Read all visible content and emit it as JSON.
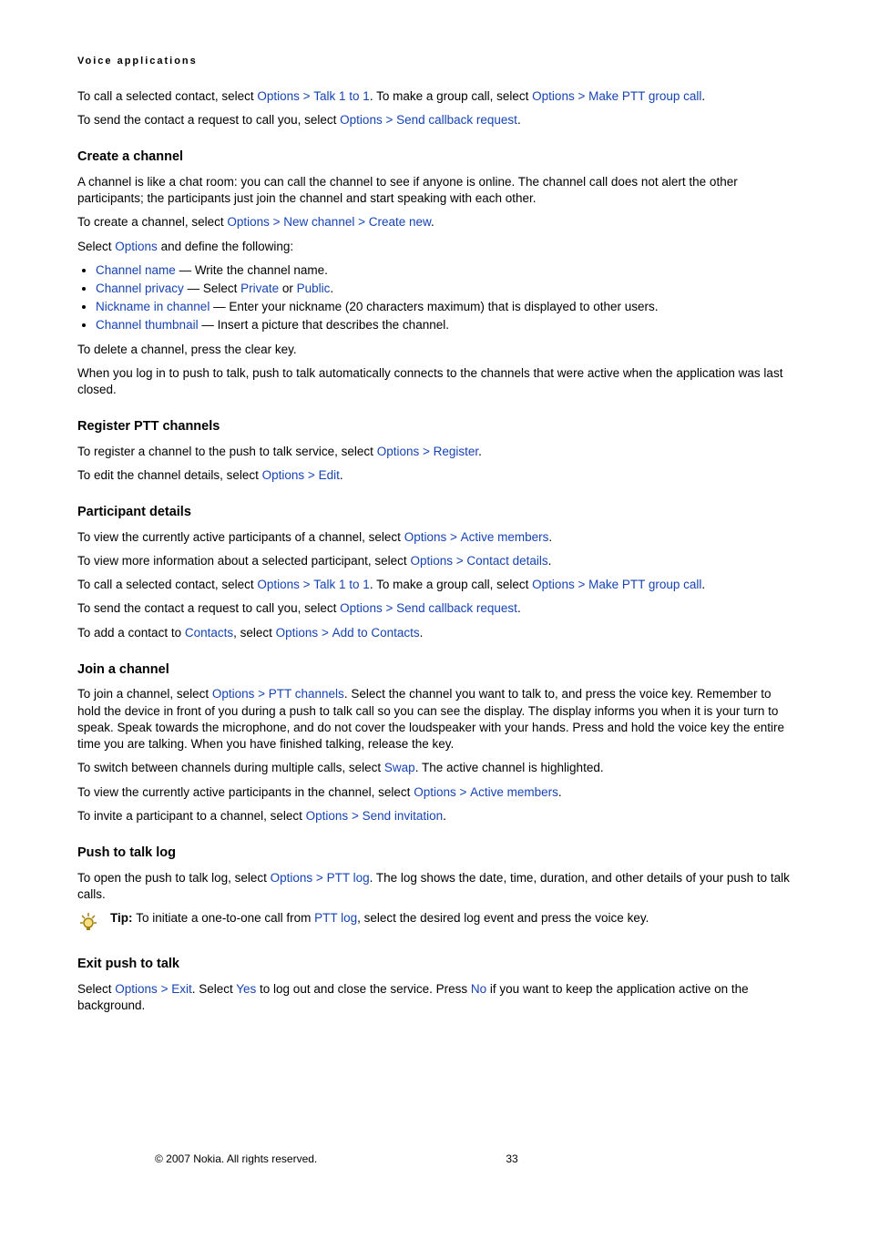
{
  "header": "Voice applications",
  "intro": [
    {
      "pre": "To call a selected contact, select ",
      "cmds": [
        [
          "Options",
          "Talk 1 to 1"
        ]
      ],
      "mid": ". To make a group call, select ",
      "cmds2": [
        [
          "Options",
          "Make PTT group call"
        ]
      ],
      "post": "."
    },
    {
      "pre": "To send the contact a request to call you, select ",
      "cmds": [
        [
          "Options",
          "Send callback request"
        ]
      ],
      "post": "."
    }
  ],
  "s1": {
    "title": "Create a channel",
    "p1": "A channel is like a chat room: you can call the channel to see if anyone is online. The channel call does not alert the other participants; the participants just join the channel and start speaking with each other.",
    "p2": {
      "pre": "To create a channel, select ",
      "cmds": [
        [
          "Options",
          "New channel",
          "Create new"
        ]
      ],
      "post": "."
    },
    "p3": {
      "pre": "Select ",
      "cmd": "Options",
      "post": " and define the following:"
    },
    "items": [
      {
        "name": "Channel name",
        "desc": " — Write the channel name."
      },
      {
        "name": "Channel privacy",
        "desc": " — Select ",
        "cmd1": "Private",
        "mid": " or ",
        "cmd2": "Public",
        "post": "."
      },
      {
        "name": "Nickname in channel",
        "desc": " — Enter your nickname (20 characters maximum) that is displayed to other users."
      },
      {
        "name": "Channel thumbnail",
        "desc": " — Insert a picture that describes the channel."
      }
    ],
    "p4": "To delete a channel, press the clear key.",
    "p5": "When you log in to push to talk, push to talk automatically connects to the channels that were active when the application was last closed."
  },
  "s2": {
    "title": "Register PTT channels",
    "p1": {
      "pre": "To register a channel to the push to talk service, select ",
      "cmds": [
        [
          "Options",
          "Register"
        ]
      ],
      "post": "."
    },
    "p2": {
      "pre": "To edit the channel details, select ",
      "cmds": [
        [
          "Options",
          "Edit"
        ]
      ],
      "post": "."
    }
  },
  "s3": {
    "title": "Participant details",
    "p1": {
      "pre": "To view the currently active participants of a channel, select ",
      "cmds": [
        [
          "Options",
          "Active members"
        ]
      ],
      "post": "."
    },
    "p2": {
      "pre": "To view more information about a selected participant, select ",
      "cmds": [
        [
          "Options",
          "Contact details"
        ]
      ],
      "post": "."
    },
    "p3": {
      "pre": "To call a selected contact, select ",
      "cmds": [
        [
          "Options",
          "Talk 1 to 1"
        ]
      ],
      "mid": ". To make a group call, select ",
      "cmds2": [
        [
          "Options",
          "Make PTT group call"
        ]
      ],
      "post": "."
    },
    "p4": {
      "pre": "To send the contact a request to call you, select ",
      "cmds": [
        [
          "Options",
          "Send callback request"
        ]
      ],
      "post": "."
    },
    "p5": {
      "pre": "To add a contact to ",
      "cmd1": "Contacts",
      "mid": ", select ",
      "cmds": [
        [
          "Options",
          "Add to Contacts"
        ]
      ],
      "post": "."
    }
  },
  "s4": {
    "title": "Join a channel",
    "p1": {
      "pre": "To join a channel, select ",
      "cmds": [
        [
          "Options",
          "PTT channels"
        ]
      ],
      "post": ". Select the channel you want to talk to, and press the voice key. Remember to hold the device in front of you during a push to talk call so you can see the display. The display informs you when it is your turn to speak. Speak towards the microphone, and do not cover the loudspeaker with your hands. Press and hold the voice key the entire time you are talking. When you have finished talking, release the key."
    },
    "p2": {
      "pre": "To switch between channels during multiple calls, select ",
      "cmd1": "Swap",
      "post": ". The active channel is highlighted."
    },
    "p3": {
      "pre": "To view the currently active participants in the channel, select ",
      "cmds": [
        [
          "Options",
          "Active members"
        ]
      ],
      "post": "."
    },
    "p4": {
      "pre": "To invite a participant to a channel, select ",
      "cmds": [
        [
          "Options",
          "Send invitation"
        ]
      ],
      "post": "."
    }
  },
  "s5": {
    "title": "Push to talk log",
    "p1": {
      "pre": "To open the push to talk log, select ",
      "cmds": [
        [
          "Options",
          "PTT log"
        ]
      ],
      "post": ". The log shows the date, time, duration, and other details of your push to talk calls."
    },
    "tip": {
      "bold": "Tip: ",
      "pre": "To initiate a one-to-one call from ",
      "cmd": "PTT log",
      "post": ", select the desired log event and press the voice key."
    }
  },
  "s6": {
    "title": "Exit push to talk",
    "p1": {
      "pre": "Select ",
      "cmds": [
        [
          "Options",
          "Exit"
        ]
      ],
      "mid": ". Select ",
      "cmd1": "Yes",
      "mid2": " to log out and close the service. Press ",
      "cmd2": "No",
      "post": " if you want to keep the application active on the background."
    }
  },
  "footer": {
    "copy": "© 2007 Nokia. All rights reserved.",
    "page": "33"
  }
}
